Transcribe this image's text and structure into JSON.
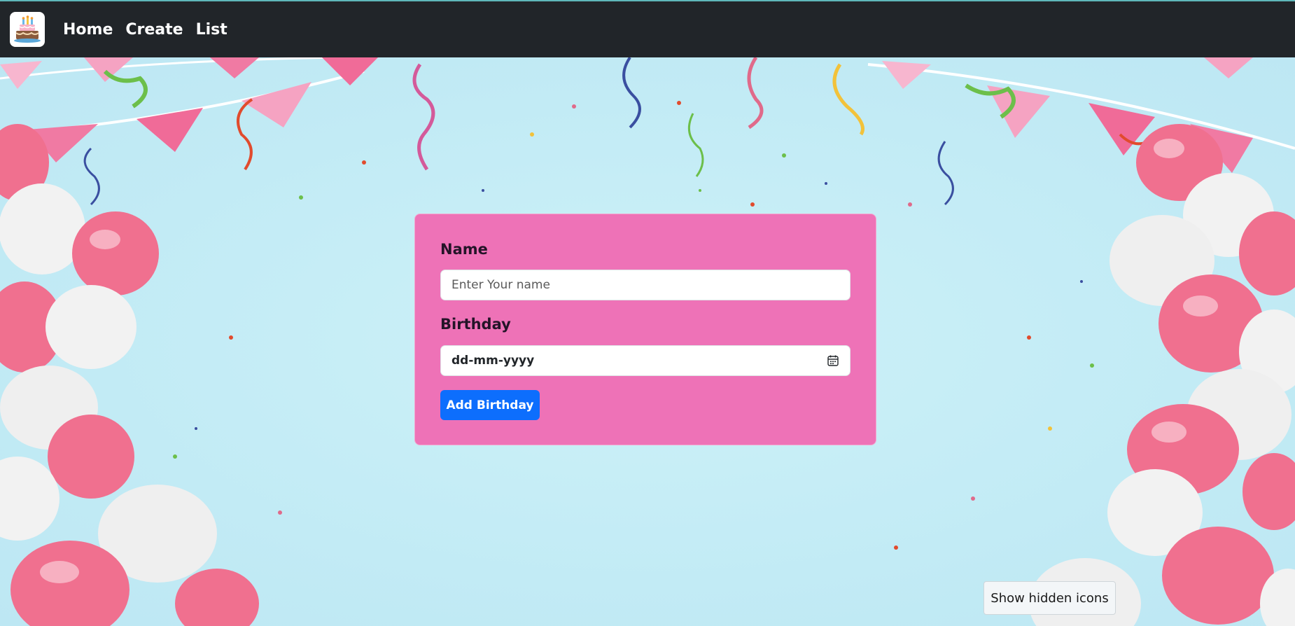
{
  "nav": {
    "logo_icon": "birthday-cake-icon",
    "links": [
      "Home",
      "Create",
      "List"
    ]
  },
  "form": {
    "name_label": "Name",
    "name_placeholder": "Enter Your name",
    "birthday_label": "Birthday",
    "birthday_placeholder": "dd-mm-yyyy",
    "calendar_icon": "calendar-icon",
    "submit_label": "Add Birthday"
  },
  "tooltip": {
    "text": "Show hidden icons"
  },
  "colors": {
    "navbar": "#212529",
    "background": "#c7eef6",
    "card": "#ee72b7",
    "button": "#0d6efd",
    "balloon_pink": "#f0708f",
    "balloon_white": "#f2f2f2"
  }
}
